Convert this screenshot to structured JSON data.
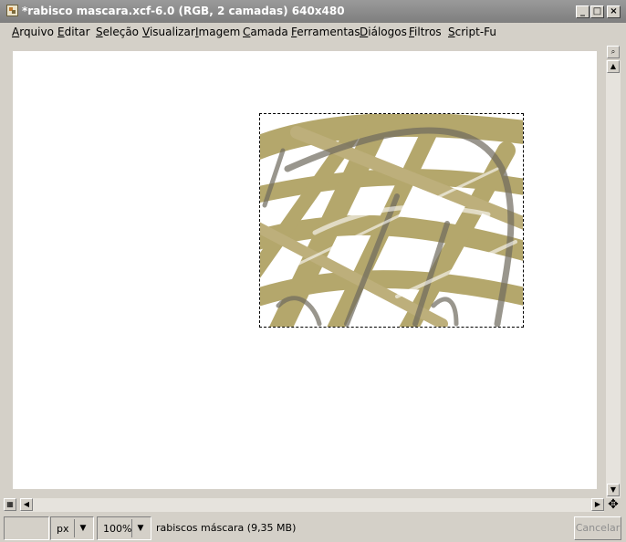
{
  "window": {
    "title": "*rabisco mascara.xcf-6.0 (RGB, 2 camadas) 640x480",
    "minimize": "_",
    "maximize": "□",
    "close": "×"
  },
  "menu": {
    "items": [
      {
        "u": "A",
        "rest": "rquivo"
      },
      {
        "u": "E",
        "rest": "ditar"
      },
      {
        "u": "S",
        "rest": "eleção"
      },
      {
        "u": "V",
        "rest": "isualizar"
      },
      {
        "u": "I",
        "rest": "magem"
      },
      {
        "u": "C",
        "rest": "amada"
      },
      {
        "u": "F",
        "rest": "erramentas"
      },
      {
        "u": "D",
        "rest": "iálogos"
      },
      {
        "u": "F",
        "rest": "iltros"
      },
      {
        "u": "S",
        "rest": "cript-Fu"
      }
    ]
  },
  "statusbar": {
    "unit": "px",
    "zoom": "100%",
    "message": "rabiscos máscara (9,35 MB)",
    "cancel_label": "Cancelar"
  },
  "colors": {
    "paint": "#9c8a3c",
    "stroke_dark": "#6f6a5e",
    "canvas": "#ffffff",
    "frame": "#d4d0c8"
  },
  "icons": {
    "zoom": "magnifier-icon",
    "quickmask": "quick-mask-icon",
    "navigate": "navigate-icon",
    "scroll_up": "arrow-up-icon",
    "scroll_down": "arrow-down-icon",
    "scroll_left": "arrow-left-icon",
    "scroll_right": "arrow-right-icon"
  }
}
